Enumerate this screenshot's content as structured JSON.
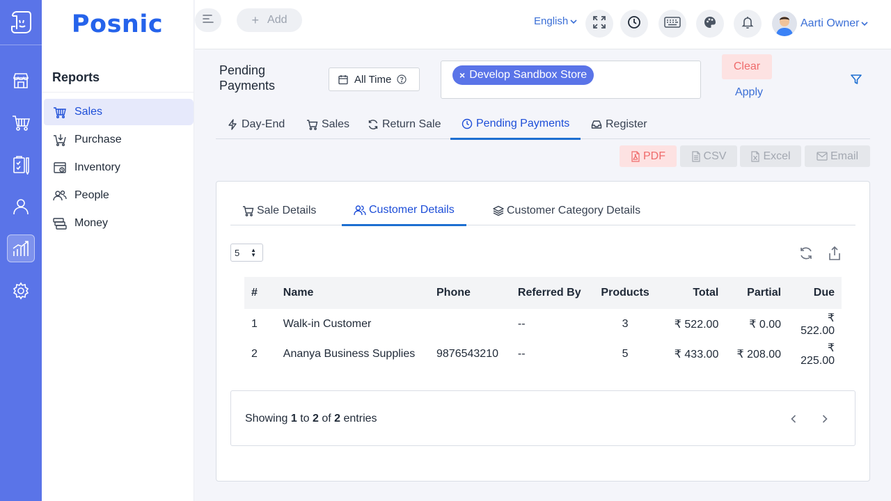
{
  "app": {
    "brand": "Posnic"
  },
  "topbar": {
    "add_label": "Add",
    "language": "English",
    "user_name": "Aarti Owner"
  },
  "sidebar": {
    "title": "Reports",
    "items": [
      {
        "label": "Sales",
        "icon": "basket-icon",
        "active": true
      },
      {
        "label": "Purchase",
        "icon": "cart-in-icon",
        "active": false
      },
      {
        "label": "Inventory",
        "icon": "box-icon",
        "active": false
      },
      {
        "label": "People",
        "icon": "people-icon",
        "active": false
      },
      {
        "label": "Money",
        "icon": "money-icon",
        "active": false
      }
    ]
  },
  "filters": {
    "page_title_line1": "Pending",
    "page_title_line2": "Payments",
    "date_range": "All Time",
    "store_chip": "Develop Sandbox Store",
    "clear_label": "Clear",
    "apply_label": "Apply"
  },
  "tabs": [
    {
      "label": "Day-End",
      "icon": "bolt-icon"
    },
    {
      "label": "Sales",
      "icon": "cart-icon"
    },
    {
      "label": "Return Sale",
      "icon": "refresh-icon"
    },
    {
      "label": "Pending Payments",
      "icon": "clock-icon",
      "active": true
    },
    {
      "label": "Register",
      "icon": "inbox-icon"
    }
  ],
  "exports": {
    "pdf": "PDF",
    "csv": "CSV",
    "excel": "Excel",
    "email": "Email"
  },
  "subtabs": [
    {
      "label": "Sale Details",
      "icon": "cart-icon"
    },
    {
      "label": "Customer Details",
      "icon": "users-icon",
      "active": true
    },
    {
      "label": "Customer Category Details",
      "icon": "layers-icon"
    }
  ],
  "table": {
    "page_size": "5",
    "columns": [
      "#",
      "Name",
      "Phone",
      "Referred By",
      "Products",
      "Total",
      "Partial",
      "Due"
    ],
    "rows": [
      {
        "num": "1",
        "name": "Walk-in Customer",
        "phone": "",
        "referred_by": "--",
        "products": "3",
        "total": "₹ 522.00",
        "partial": "₹ 0.00",
        "due": "₹ 522.00"
      },
      {
        "num": "2",
        "name": "Ananya Business Supplies",
        "phone": "9876543210",
        "referred_by": "--",
        "products": "5",
        "total": "₹ 433.00",
        "partial": "₹ 208.00",
        "due": "₹ 225.00"
      }
    ]
  },
  "pagination": {
    "prefix": "Showing",
    "from": "1",
    "to_word": "to",
    "to": "2",
    "of_word": "of",
    "total": "2",
    "suffix": "entries"
  },
  "colors": {
    "rail": "#5a74e8",
    "accent": "#1d6fd1",
    "brand": "#2563eb",
    "danger_bg": "#fde2e2",
    "danger_text": "#ef6b6b"
  }
}
